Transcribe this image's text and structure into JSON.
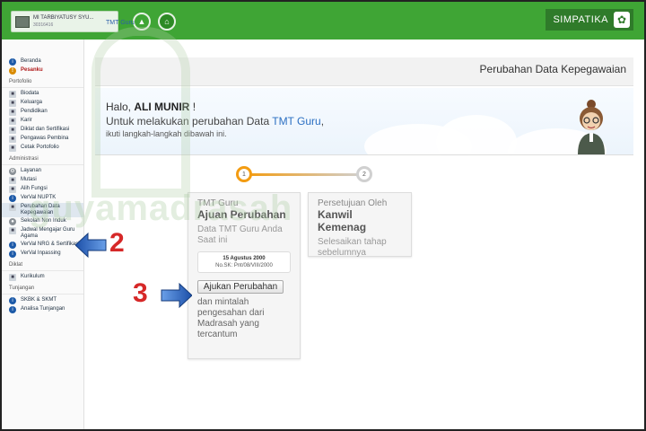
{
  "header": {
    "school_name": "MI TARBIYATUSY SYU...",
    "school_id": "30316416",
    "brand": "SIMPATIKA"
  },
  "sidebar": {
    "top": [
      {
        "label": "Beranda"
      },
      {
        "label": "Pesanku"
      }
    ],
    "sections": [
      {
        "title": "Portofolio",
        "items": [
          "Biodata",
          "Keluarga",
          "Pendidikan",
          "Karir",
          "Diklat dan Sertifikasi",
          "Pengawas Pembina",
          "Cetak Portofolio"
        ]
      },
      {
        "title": "Administrasi",
        "items": [
          "Layanan",
          "Mutasi",
          "Alih Fungsi",
          "VerVal NUPTK",
          "Perubahan Data Kepegawaian",
          "Sekolah Non Induk",
          "Jadwal Mengajar Guru Agama",
          "VerVal NRG & Sertifikasi",
          "VerVal Inpassing"
        ]
      },
      {
        "title": "Diklat",
        "items": [
          "Kurikulum"
        ]
      },
      {
        "title": "Tunjangan",
        "items": [
          "SKBK & SKMT",
          "Analisa Tunjangan"
        ]
      }
    ]
  },
  "page": {
    "title": "Perubahan Data Kepegawaian",
    "breadcrumb": "TMT Guru",
    "greeting_prefix": "Halo, ",
    "greeting_name": "ALI MUNIR",
    "greeting_suffix": " !",
    "intro_prefix": "Untuk melakukan perubahan Data ",
    "intro_link": "TMT Guru",
    "intro_suffix": ",",
    "intro_line2": "ikuti langkah-langkah dibawah ini."
  },
  "steps": {
    "step1_number": "1",
    "step2_number": "2",
    "card1": {
      "small": "TMT Guru",
      "title": "Ajuan Perubahan",
      "desc": "Data TMT Guru Anda Saat ini",
      "date": "15 Agustus 2000",
      "sk": "No.SK: Pnt/08/VIII/2000",
      "button": "Ajukan Perubahan",
      "after": "dan mintalah pengesahan dari Madrasah yang tercantum"
    },
    "card2": {
      "small": "Persetujuan Oleh",
      "title": "Kanwil Kemenag",
      "desc": "Selesaikan tahap sebelumnya"
    }
  },
  "annotations": {
    "label_2": "2",
    "label_3": "3",
    "color": "#d62828"
  },
  "watermark": "guyamadrasah",
  "colors": {
    "topbar": "#3fa535",
    "accent": "#f39c12",
    "link": "#2b6fc2"
  }
}
